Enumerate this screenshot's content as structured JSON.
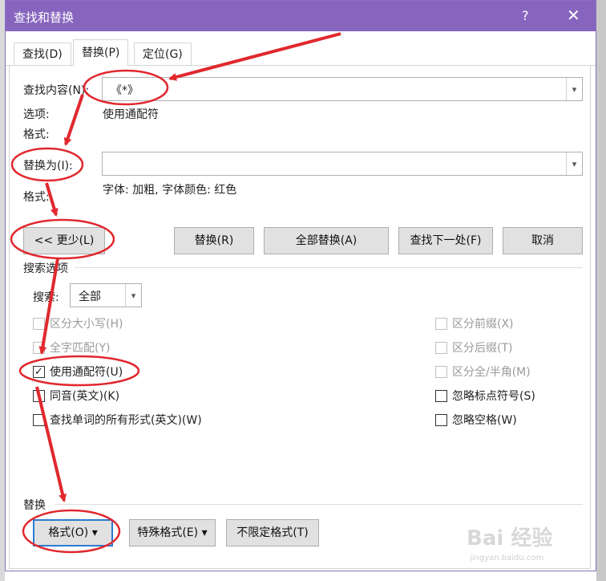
{
  "window": {
    "title": "查找和替换",
    "help_label": "?",
    "close_label": "✕"
  },
  "tabs": [
    {
      "label": "查找(D)"
    },
    {
      "label": "替换(P)"
    },
    {
      "label": "定位(G)"
    }
  ],
  "find": {
    "label": "查找内容(N):",
    "value": "《*》",
    "options_label": "选项:",
    "options_value": "使用通配符",
    "format_label": "格式:"
  },
  "replace": {
    "label": "替换为(I):",
    "value": "",
    "format_label": "格式:",
    "format_value": "字体: 加粗, 字体颜色: 红色"
  },
  "buttons": {
    "less": "<< 更少(L)",
    "replace": "替换(R)",
    "replace_all": "全部替换(A)",
    "find_next": "查找下一处(F)",
    "cancel": "取消"
  },
  "search_options": {
    "heading": "搜索选项",
    "search_label": "搜索:",
    "search_value": "全部"
  },
  "checkboxes_left": [
    {
      "label": "区分大小写(H)",
      "checked": false,
      "enabled": false
    },
    {
      "label": "全字匹配(Y)",
      "checked": false,
      "enabled": false
    },
    {
      "label": "使用通配符(U)",
      "checked": true,
      "enabled": true
    },
    {
      "label": "同音(英文)(K)",
      "checked": false,
      "enabled": true
    },
    {
      "label": "查找单词的所有形式(英文)(W)",
      "checked": false,
      "enabled": true
    }
  ],
  "checkboxes_right": [
    {
      "label": "区分前缀(X)",
      "checked": false,
      "enabled": false
    },
    {
      "label": "区分后缀(T)",
      "checked": false,
      "enabled": false
    },
    {
      "label": "区分全/半角(M)",
      "checked": false,
      "enabled": false
    },
    {
      "label": "忽略标点符号(S)",
      "checked": false,
      "enabled": true
    },
    {
      "label": "忽略空格(W)",
      "checked": false,
      "enabled": true
    }
  ],
  "replace_section": {
    "heading": "替换",
    "format_button": "格式(O)",
    "special_button": "特殊格式(E)",
    "no_format_button": "不限定格式(T)"
  },
  "watermark": {
    "brand": "Bai  经验",
    "url": "jingyan.baidu.com"
  },
  "colors": {
    "title_bar": "#8765be",
    "annotation": "#e0282e",
    "focus": "#2b7bd1"
  }
}
